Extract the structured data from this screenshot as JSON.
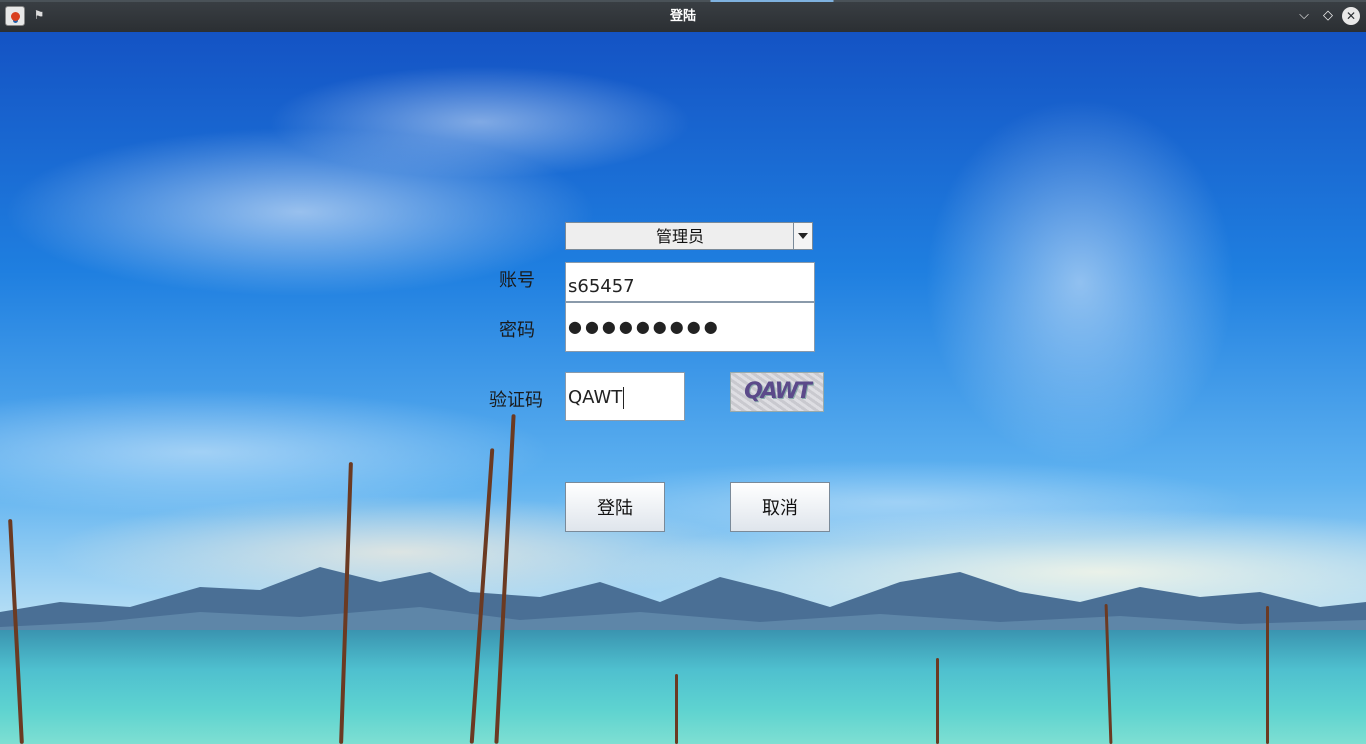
{
  "window": {
    "title": "登陆",
    "icons": {
      "app": "java-app-icon",
      "pin": "pin-icon",
      "minimize": "chevron-down-icon",
      "maximize": "diamond-icon",
      "close": "close-icon"
    }
  },
  "form": {
    "role_select": {
      "selected": "管理员"
    },
    "account": {
      "label": "账号",
      "value": "s65457"
    },
    "password": {
      "label": "密码",
      "masked_value": "●●●●●●●●●"
    },
    "captcha": {
      "label": "验证码",
      "value": "QAWT",
      "image_text": "QAWT"
    },
    "login_button": "登陆",
    "cancel_button": "取消"
  },
  "colors": {
    "titlebar": "#2b2f33",
    "sky": "#1f7fe0",
    "water": "#4fc0cf"
  }
}
